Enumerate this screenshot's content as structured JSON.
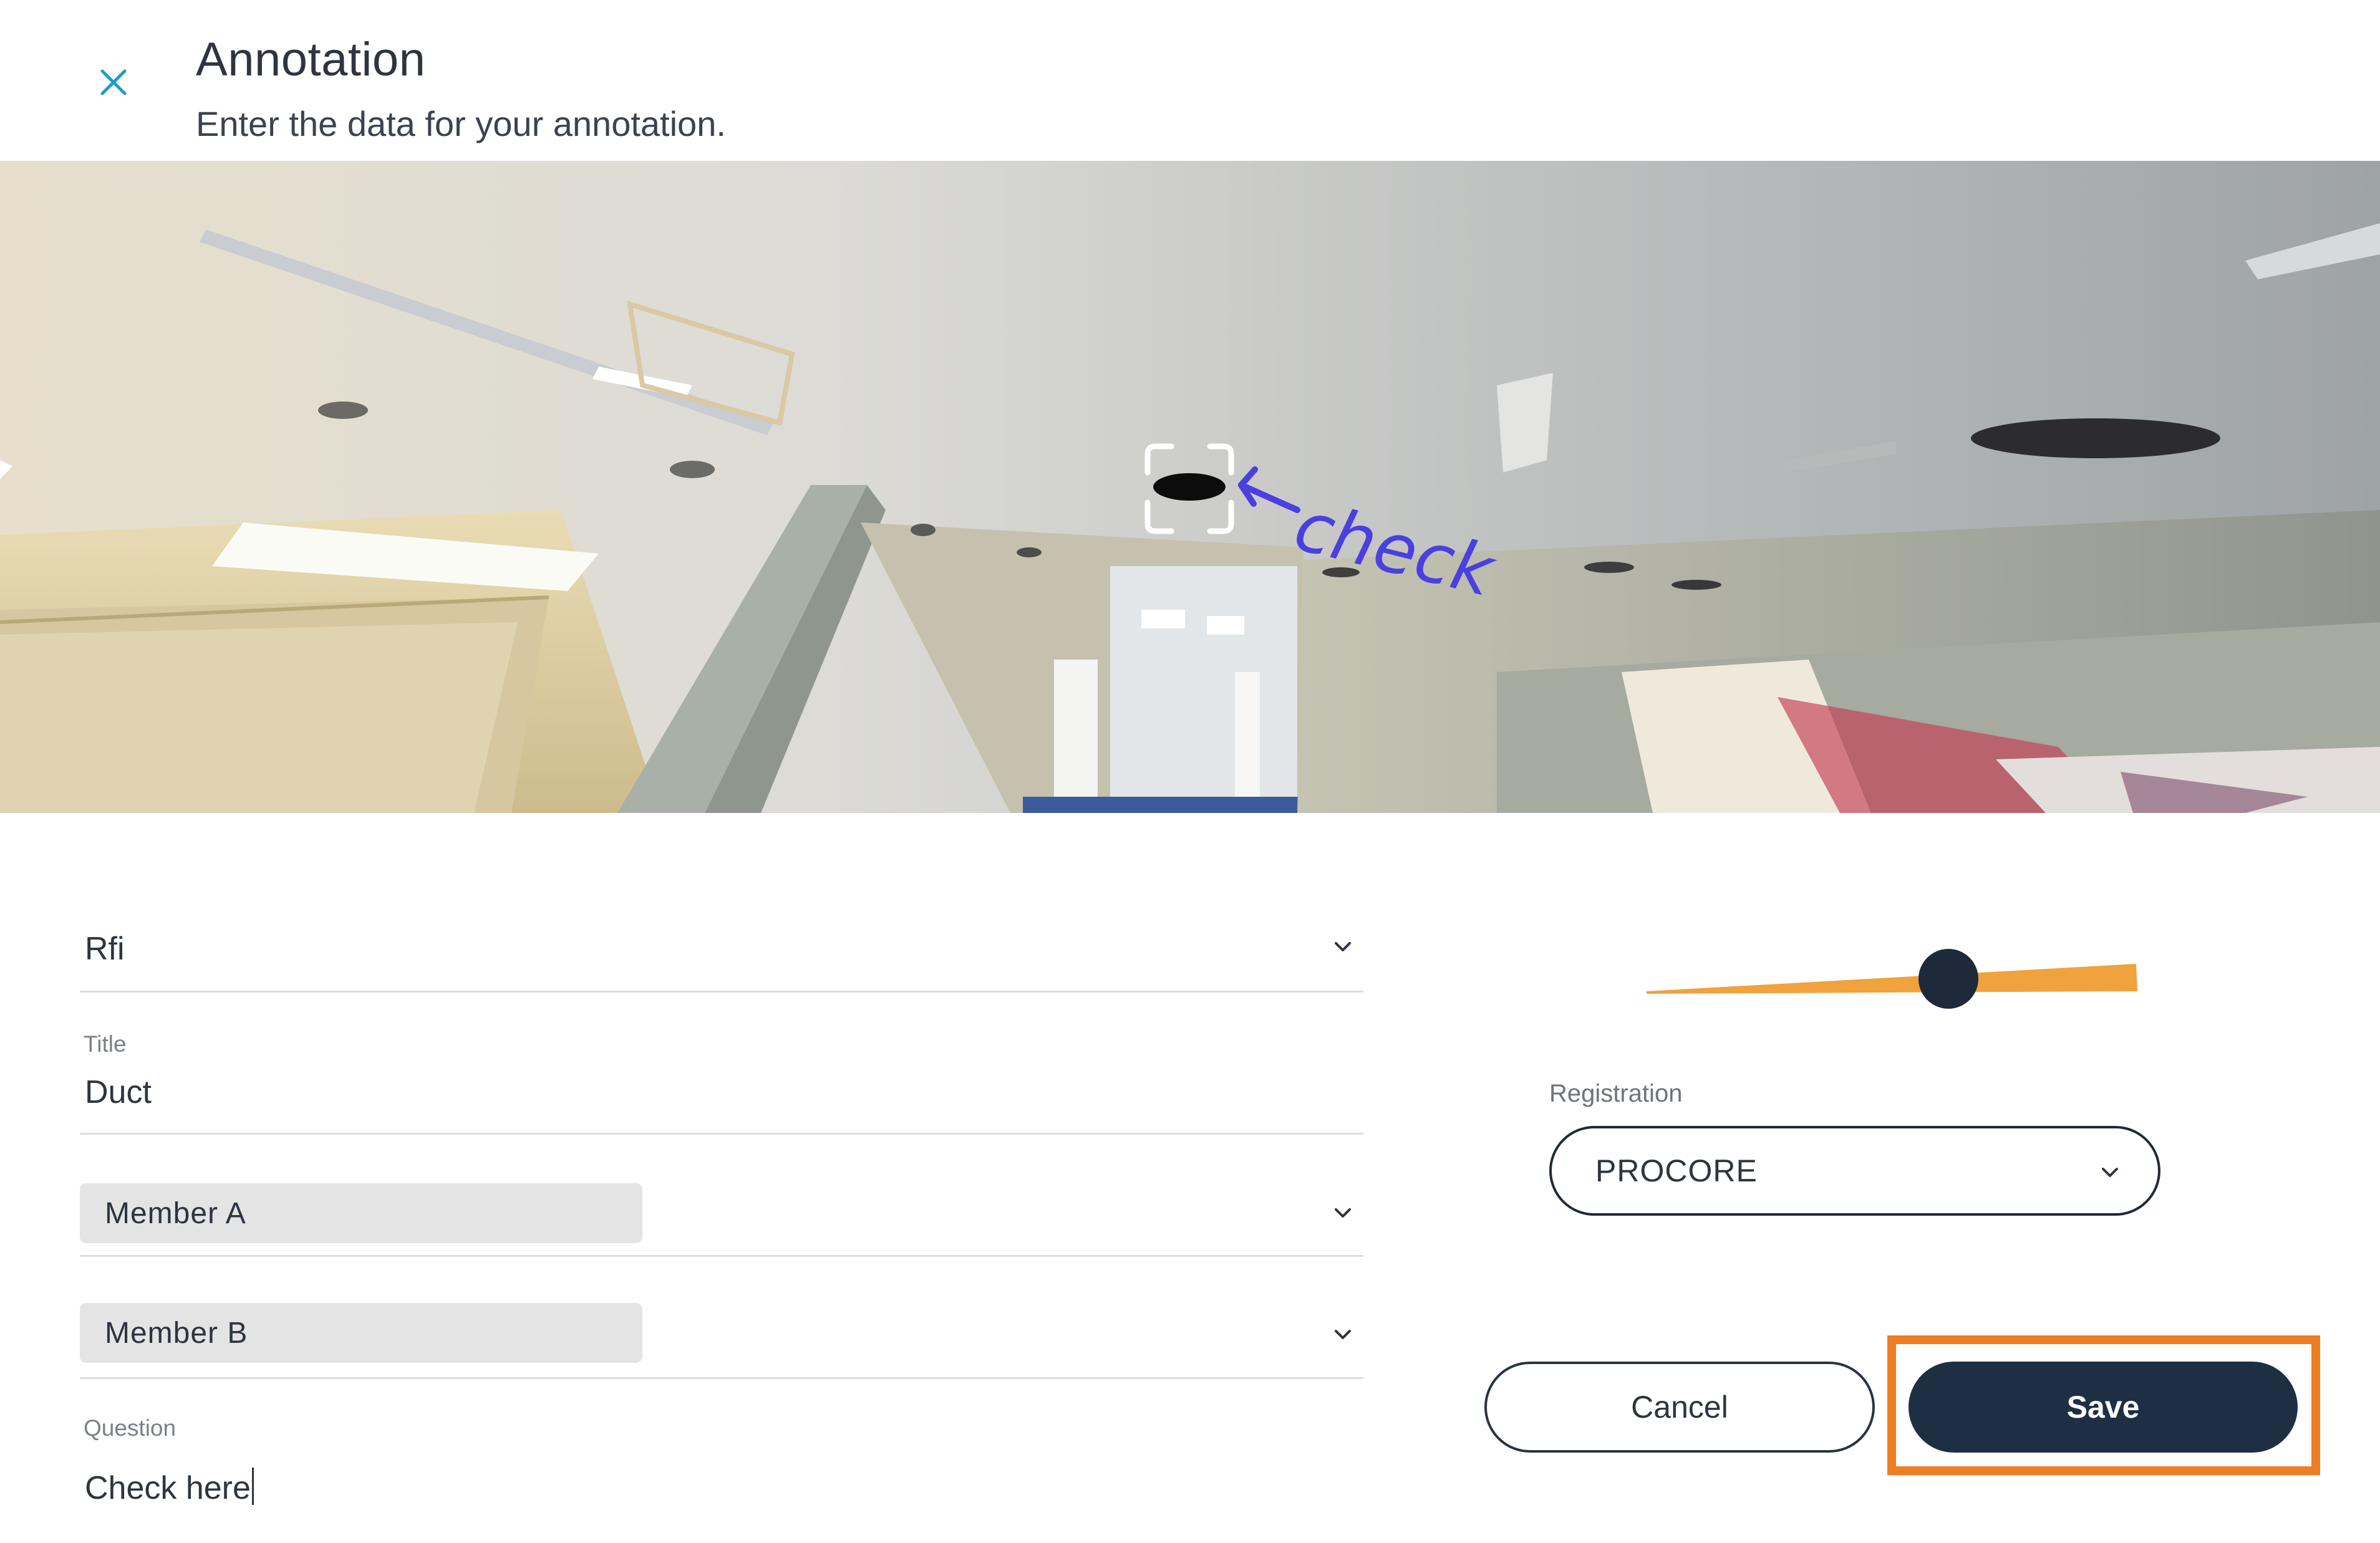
{
  "header": {
    "title": "Annotation",
    "subtitle": "Enter the data for your annotation.",
    "close_icon": "close-icon",
    "close_color": "#1a9ec9"
  },
  "panorama": {
    "markup_text": "check",
    "markup_color": "#4b3fe0"
  },
  "form": {
    "type_value": "Rfi",
    "title_label": "Title",
    "title_value": "Duct",
    "member_a": "Member A",
    "member_b": "Member B",
    "question_label": "Question",
    "question_value": "Check here"
  },
  "slider": {
    "value_fraction": 0.62,
    "track_color": "#f0a23c",
    "thumb_color": "#1e2a3a"
  },
  "registration": {
    "label": "Registration",
    "value": "PROCORE"
  },
  "buttons": {
    "cancel": "Cancel",
    "save": "Save",
    "highlight_color": "#ef7d22"
  }
}
